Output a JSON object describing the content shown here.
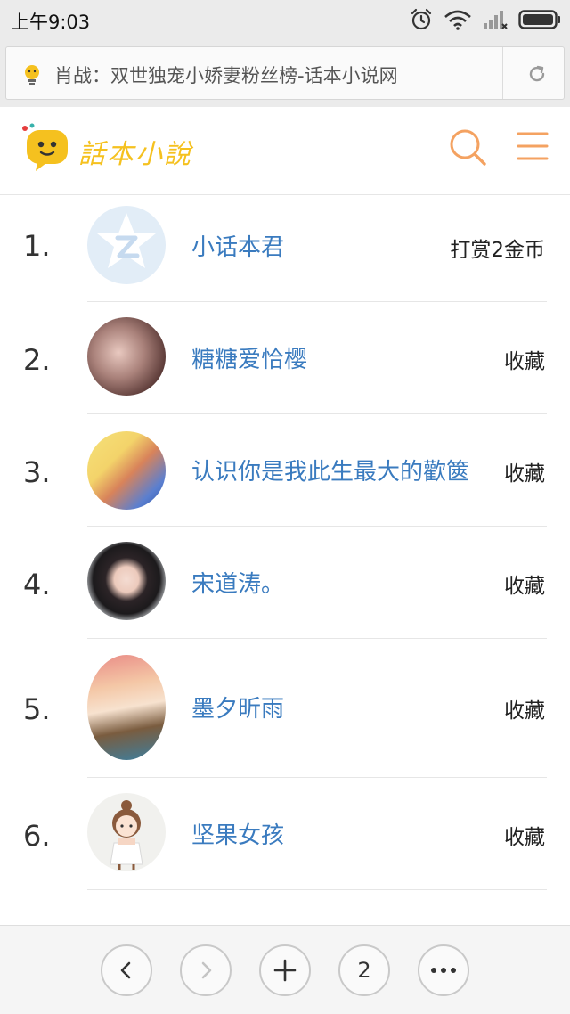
{
  "status_bar": {
    "time": "上午9:03",
    "icons": [
      "alarm-icon",
      "wifi-icon",
      "signal-icon",
      "battery-icon"
    ]
  },
  "address_bar": {
    "title": "肖战：双世独宠小娇妻粉丝榜-话本小说网",
    "icons": [
      "bulb-icon",
      "refresh-icon"
    ]
  },
  "site": {
    "logo_text": "話本小說",
    "icons": [
      "search-icon",
      "menu-icon"
    ],
    "accent_color": "#f4a261",
    "link_color": "#3a7bbf"
  },
  "fans": [
    {
      "rank": "1.",
      "name": "小话本君",
      "action": "打赏2金币",
      "avatar": "default-avatar-icon"
    },
    {
      "rank": "2.",
      "name": "糖糖爱恰樱",
      "action": "收藏",
      "avatar": "user-photo"
    },
    {
      "rank": "3.",
      "name": "认识你是我此生最大的歡篋",
      "action": "收藏",
      "avatar": "anime-couple-avatar"
    },
    {
      "rank": "4.",
      "name": "宋道涛。",
      "action": "收藏",
      "avatar": "portrait-avatar"
    },
    {
      "rank": "5.",
      "name": "墨夕昕雨",
      "action": "收藏",
      "avatar": "anime-girl-avatar"
    },
    {
      "rank": "6.",
      "name": "坚果女孩",
      "action": "收藏",
      "avatar": "cartoon-girl-avatar"
    }
  ],
  "toolbar": {
    "back_icon": "back-icon",
    "forward_icon": "forward-icon",
    "add_icon": "plus-icon",
    "tab_count": "2",
    "more_icon": "more-icon"
  }
}
